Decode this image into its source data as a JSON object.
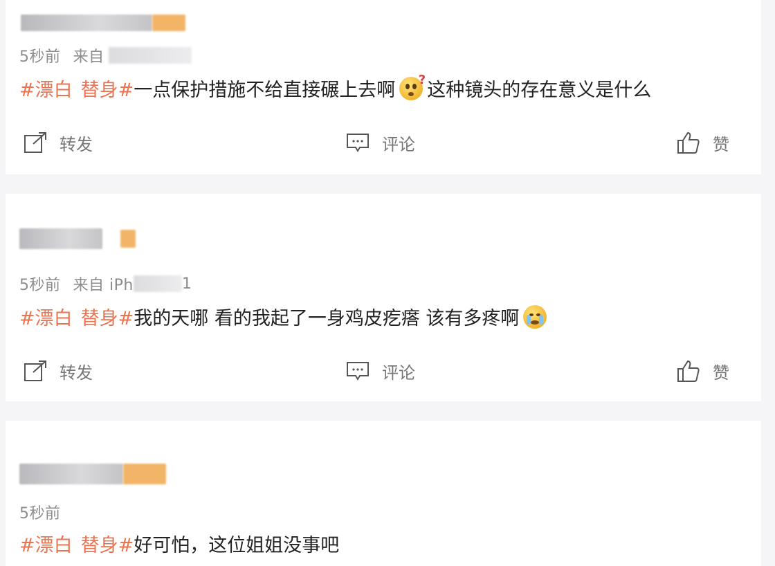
{
  "posts": [
    {
      "meta_time": "5秒前",
      "meta_source_prefix": "来自",
      "tag_left": "#漂白",
      "tag_right": "替身#",
      "text_a": "一点保护措施不给直接碾上去啊",
      "emoji_a": "question-face-emoji",
      "text_b": "这种镜头的存在意义是什么",
      "repost_label": "转发",
      "comment_label": "评论",
      "like_label": "赞"
    },
    {
      "meta_time": "5秒前",
      "meta_source_prefix": "来自 iPh",
      "meta_source_suffix": "1",
      "tag_left": "#漂白",
      "tag_right": "替身#",
      "text_a": "我的天哪 看的我起了一身鸡皮疙瘩 该有多疼啊",
      "emoji_a": "crying-face-emoji",
      "repost_label": "转发",
      "comment_label": "评论",
      "like_label": "赞"
    },
    {
      "meta_time": "5秒前",
      "tag_left": "#漂白",
      "tag_right": "替身#",
      "text_a": "好可怕，这位姐姐没事吧"
    }
  ],
  "colors": {
    "tag": "#eb7350",
    "meta": "#8c8c8c",
    "text": "#222222",
    "background": "#f5f5f7"
  }
}
